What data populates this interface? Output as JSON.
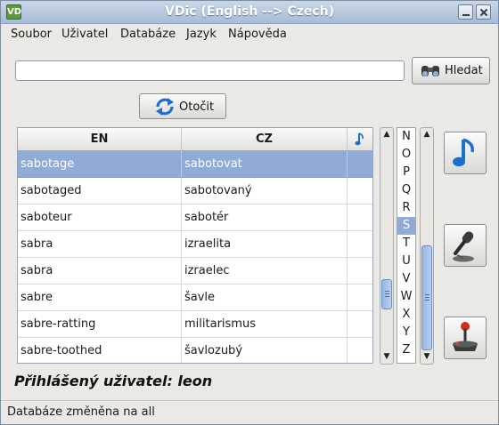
{
  "window": {
    "title": "VDic (English --> Czech)",
    "app_icon": "VD"
  },
  "menu": [
    "Soubor",
    "Uživatel",
    "Databáze",
    "Jazyk",
    "Nápověda"
  ],
  "search": {
    "value": "",
    "placeholder": "",
    "button_label": "Hledat",
    "button_icon": "binoculars-icon"
  },
  "rotate": {
    "label": "Otočit",
    "icon": "rotate-arrows-icon"
  },
  "table": {
    "columns": [
      "EN",
      "CZ"
    ],
    "sound_column_icon": "music-note-icon",
    "rows": [
      {
        "en": "sabotage",
        "cz": "sabotovat",
        "selected": true
      },
      {
        "en": "sabotaged",
        "cz": "sabotovaný",
        "selected": false
      },
      {
        "en": "saboteur",
        "cz": "sabotér",
        "selected": false
      },
      {
        "en": "sabra",
        "cz": "izraelita",
        "selected": false
      },
      {
        "en": "sabra",
        "cz": "izraelec",
        "selected": false
      },
      {
        "en": "sabre",
        "cz": "šavle",
        "selected": false
      },
      {
        "en": "sabre-ratting",
        "cz": "militarismus",
        "selected": false
      },
      {
        "en": "sabre-toothed",
        "cz": "šavlozubý",
        "selected": false
      }
    ]
  },
  "letters": {
    "items": [
      "N",
      "O",
      "P",
      "Q",
      "R",
      "S",
      "T",
      "U",
      "V",
      "W",
      "X",
      "Y",
      "Z"
    ],
    "selected": "S"
  },
  "side_buttons": [
    {
      "name": "play-sound-button",
      "icon": "music-note-icon"
    },
    {
      "name": "record-button",
      "icon": "microphone-icon"
    },
    {
      "name": "game-button",
      "icon": "joystick-icon"
    }
  ],
  "user_status": "Přihlášený uživatel: leon",
  "status_bar": "Databáze změněna na all",
  "colors": {
    "selection": "#8fabd6",
    "accent_blue": "#1c6fd1",
    "titlebar": "#a8bcd6"
  }
}
